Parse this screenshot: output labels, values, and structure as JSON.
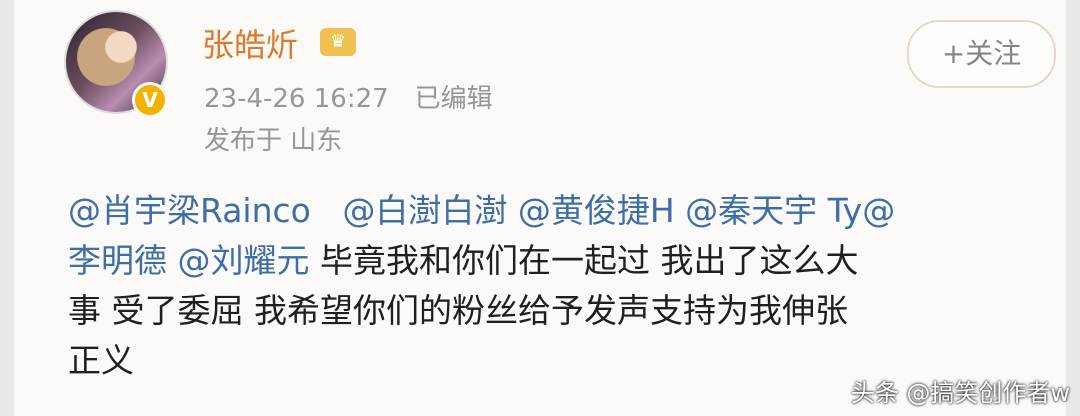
{
  "post": {
    "author": "张皓炘",
    "timestamp": "23-4-26 16:27",
    "edited_label": "已编辑",
    "location": "发布于 山东",
    "follow_label": "+关注",
    "line1": {
      "m1": "@肖宇梁Rainco",
      "m2": "@白澍白澍",
      "m3": "@黄俊捷H",
      "m4": "@秦天宇 Ty@"
    },
    "line2": {
      "m5": "李明德",
      "m6": "@刘耀元",
      "text": " 毕竟我和你们在一起过 我出了这么大"
    },
    "line3": "事 受了委屈 我希望你们的粉丝给予发声支持为我伸张",
    "line4": "正义"
  },
  "watermark": "头条 @搞笑创作者w",
  "icons": {
    "verified": "verified-badge-icon",
    "crown": "crown-icon"
  },
  "colors": {
    "username": "#e0772a",
    "mention": "#3e6ea6",
    "meta": "#9a9593"
  }
}
